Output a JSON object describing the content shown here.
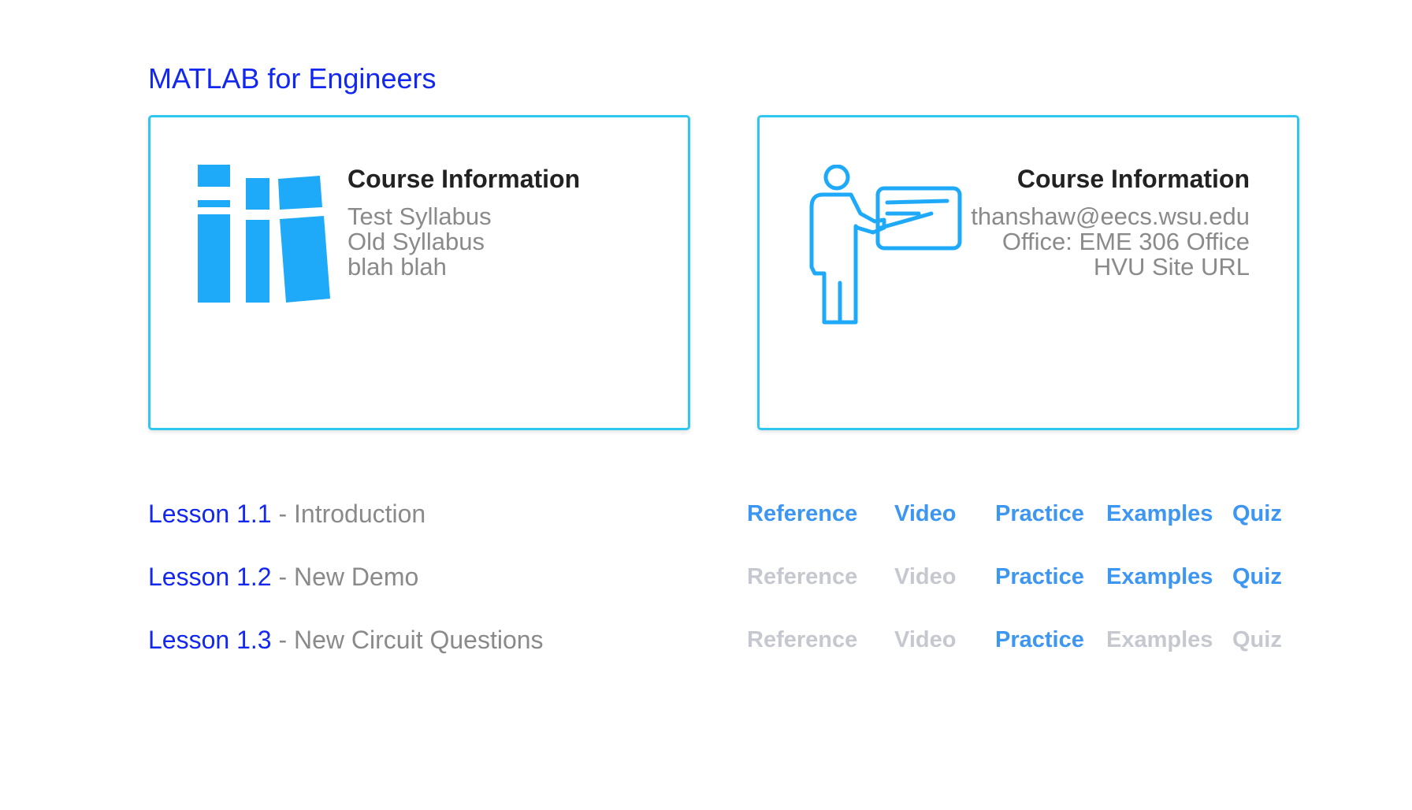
{
  "course": {
    "title": "MATLAB for Engineers"
  },
  "cards": {
    "left": {
      "icon": "library-books-icon",
      "heading": "Course Information",
      "lines": [
        "Test Syllabus",
        "Old Syllabus",
        "blah blah"
      ]
    },
    "right": {
      "icon": "teacher-presentation-icon",
      "heading": "Course Information",
      "lines": [
        "thanshaw@eecs.wsu.edu",
        "Office: EME 306 Office",
        "HVU Site URL"
      ]
    }
  },
  "lessons": [
    {
      "number": "Lesson 1.1",
      "separator": " - ",
      "name": "Introduction",
      "links": {
        "reference": "Reference",
        "video": "Video",
        "practice": "Practice",
        "examples": "Examples",
        "quiz": "Quiz"
      }
    },
    {
      "number": "Lesson 1.2",
      "separator": " - ",
      "name": "New Demo",
      "links": {
        "reference": "Reference",
        "video": "Video",
        "practice": "Practice",
        "examples": "Examples",
        "quiz": "Quiz"
      }
    },
    {
      "number": "Lesson 1.3",
      "separator": " - ",
      "name": "New Circuit Questions",
      "links": {
        "reference": "Reference",
        "video": "Video",
        "practice": "Practice",
        "examples": "Examples",
        "quiz": "Quiz"
      }
    }
  ],
  "colors": {
    "accent_border": "#2fc6ef",
    "title_blue": "#1228f0",
    "link_active": "#3d96f2",
    "link_inactive": "#c5c8ce",
    "icon_blue": "#1faaf9"
  }
}
